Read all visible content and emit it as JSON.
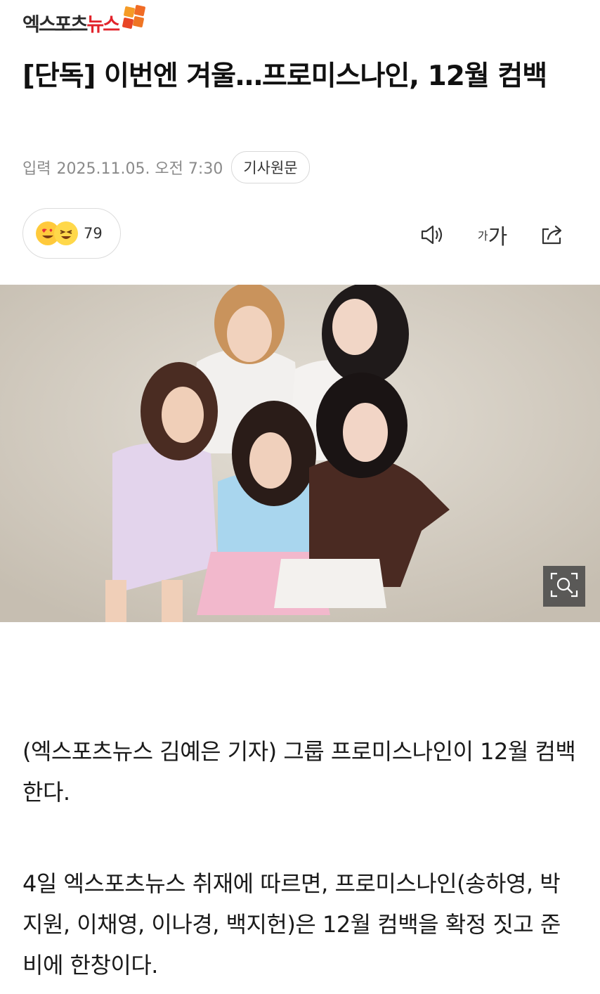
{
  "header": {
    "logo_text_dark": "엑스포츠",
    "logo_text_red": "뉴스"
  },
  "article": {
    "title": "[단독] 이번엔 겨울…프로미스나인, 12월 컴백",
    "meta_label": "입력",
    "date": "2025.11.05. 오전 7:30",
    "origin_button": "기사원문"
  },
  "toolbar": {
    "reaction_count": "79",
    "reaction_icons": [
      "heart-eyes-emoji-icon",
      "laughing-emoji-icon"
    ],
    "font_small": "가",
    "font_large": "가",
    "icons": [
      "speaker-icon",
      "font-size-icon",
      "share-icon"
    ]
  },
  "photo": {
    "zoom_icon": "magnifier-zoom-icon"
  },
  "body": {
    "paragraphs": [
      "(엑스포츠뉴스 김예은 기자) 그룹 프로미스나인이 12월 컴백한다.",
      "4일 엑스포츠뉴스 취재에 따르면, 프로미스나인(송하영, 박지원, 이채영, 이나경, 백지헌)은 12월 컴백을 확정 짓고 준비에 한창이다."
    ]
  },
  "colors": {
    "logo_red": "#e2232b",
    "logo_orange": "#f07a22",
    "meta_gray": "#8a8a8a",
    "border_gray": "#dcdcdc"
  }
}
